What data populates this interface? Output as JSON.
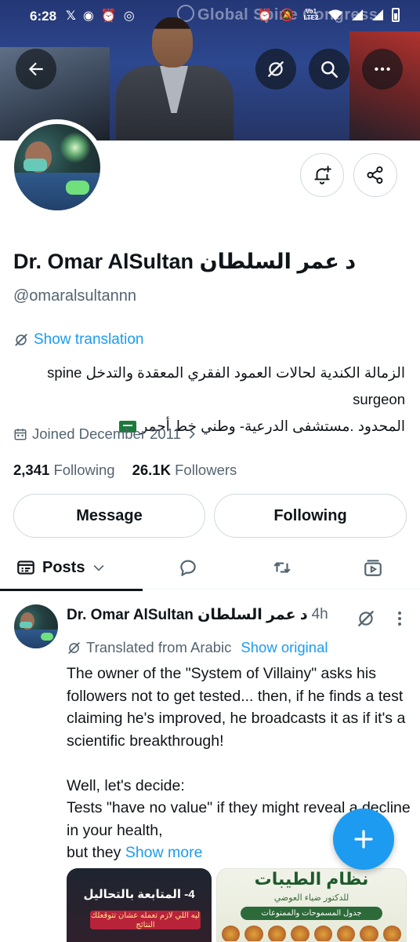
{
  "status_bar": {
    "time": "6:28",
    "left_icons": [
      "x-logo-icon",
      "messenger-icon",
      "alarm-icon",
      "instagram-icon"
    ],
    "right_icons": [
      "alarm-icon",
      "mute-icon",
      "volte-icon",
      "wifi-icon",
      "signal-icon",
      "signal-icon",
      "battery-icon"
    ],
    "volte_label": "Vo1 LTE2"
  },
  "banner": {
    "screen_text": "Global Spine Congress",
    "icons": [
      "back-arrow-icon",
      "grok-icon",
      "search-icon",
      "more-icon"
    ]
  },
  "profile": {
    "display_name": "Dr. Omar AlSultan د عمر السلطان",
    "handle": "@omaralsultannn",
    "show_translation": "Show translation",
    "bio_line1_ltr": "spine surgeon",
    "bio_line1_rtl": "الزمالة الكندية لحالات العمود الفقري المعقدة والتدخل",
    "bio_line2": "المحدود .مستشفى الدرعية- وطني خط أحمر",
    "joined": "Joined December 2011",
    "following_count": "2,341",
    "following_label": "Following",
    "followers_count": "26.1K",
    "followers_label": "Followers",
    "message_button": "Message",
    "following_button": "Following"
  },
  "tabs": {
    "posts_label": "Posts",
    "icons": [
      "posts-icon",
      "replies-icon",
      "reposts-icon",
      "media-icon"
    ]
  },
  "post": {
    "author_name": "Dr. Omar AlSultan د عمر السلطان",
    "time": "· 4h",
    "translated_label": "Translated from Arabic",
    "show_original": "Show original",
    "text": "The owner of the \"System of Villainy\" asks his followers not to get tested... then, if he finds a test claiming he's improved, he broadcasts it as if it's a scientific breakthrough!\n\nWell, let's decide:\nTests \"have no value\" if they might reveal a decline in your health,\nbut they ",
    "show_more": "Show more",
    "media1_title": "4- المتابعة بالتحاليل",
    "media1_sub": "ليه اللي لازم تعمله عشان تتوقعلك النتائج",
    "media2_title": "نظام الطيبات",
    "media2_sub": "للدكتور ضياء العوضي",
    "media2_bar": "جدول المسموحات والممنوعات"
  },
  "fab": {
    "icon": "plus-icon"
  },
  "colors": {
    "accent": "#1d9bf0",
    "text_primary": "#0f1419",
    "text_secondary": "#536471",
    "border": "#cfd9de"
  }
}
